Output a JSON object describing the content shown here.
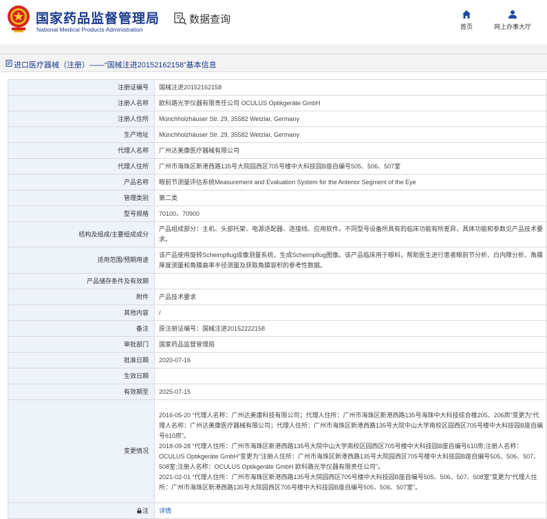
{
  "header": {
    "logo_cn": "国家药品监督管理局",
    "logo_en": "National Medical Products Administration",
    "query_label": "数据查询",
    "nav": [
      {
        "label": "首页",
        "icon": "home-icon"
      },
      {
        "label": "网上办事大厅",
        "icon": "user-icon"
      }
    ]
  },
  "panel": {
    "title": "进口医疗器械（注册）——“国械注进20152162158”基本信息",
    "title_icon": "document-icon"
  },
  "details": [
    {
      "label": "注册证编号",
      "value": "国械注进20152162158"
    },
    {
      "label": "注册人名称",
      "value": "欧科路光学仪器有限责任公司 OCULUS Optikgeräte GmbH"
    },
    {
      "label": "注册人住所",
      "value": "Münchholzhäuser Str. 29, 35582 Wetzlar, Germany"
    },
    {
      "label": "生产地址",
      "value": "Münchholzhäuser Str. 29, 35582 Wetzlar, Germany"
    },
    {
      "label": "代理人名称",
      "value": "广州达美康医疗器械有限公司"
    },
    {
      "label": "代理人住所",
      "value": "广州市海珠区新港西路135号大院园西区705号楼中大科技园B座自编号505、506、507室"
    },
    {
      "label": "产品名称",
      "value": "眼前节测量评估系统Measurement and Evaluation System for the Anterior Segment of the Eye"
    },
    {
      "label": "管理类别",
      "value": "第二类"
    },
    {
      "label": "型号规格",
      "value": "70100、70900"
    },
    {
      "label": "结构及组成/主要组成成分",
      "value": "产品组成部分：主机、头部托架、电源适配器、连接线、应用软件。不同型号设备所具有的临床功能有所差异，具体功能和参数见产品技术要求。"
    },
    {
      "label": "适用范围/预期用途",
      "value": "该产品使用旋转Scheimpflug成像测量系统，生成Scheimpflug图像。该产品临床用于眼科，帮助医生进行患者眼前节分析、白内障分析、角膜厚度测量和角膜曲率半径测量及获取角膜容积的参考性数据。"
    },
    {
      "label": "产品储存条件及有效期",
      "value": ""
    },
    {
      "label": "附件",
      "value": "产品技术要求"
    },
    {
      "label": "其他内容",
      "value": "/"
    },
    {
      "label": "备注",
      "value": "原注册证编号：国械注进20152222158"
    },
    {
      "label": "审批部门",
      "value": "国家药品监督管理局"
    },
    {
      "label": "批准日期",
      "value": "2020-07-16"
    },
    {
      "label": "生效日期",
      "value": ""
    },
    {
      "label": "有效期至",
      "value": "2025-07-15"
    }
  ],
  "change": {
    "label": "变更情况",
    "entries": [
      "2016-05-20 “代理人名称：广州达美康科技有限公司；代理人住所：广州市海珠区新港西路135号海珠中大科技综合楼205、206房”变更为“代理人名称：广州达美康医疗器械有限公司；代理人住所：广州市海珠区新港西路135号大院中山大学南校区园西区705号楼中大科技园B座自编号610房”。",
      "2018-09-28 “代理人住所：广州市海珠区新港西路135号大院中山大学南校区园西区705号楼中大科技园B座自编号610房;注册人名称：OCULUS Optikgeräte GmbH”变更为“注册人住所：广州市海珠区新港西路135号大院园西区705号楼中大科技园B座自编号505、506、507、508室;注册人名称：OCULUS Optikgeräte GmbH 欧科路光学仪器有限责任公司”。",
      "2021-02-01 “代理人住所：广州市海珠区新港西路135号大院园西区705号楼中大科技园B座自编号505、506、507、508室”变更为“代理人住所：广州市海珠区新港西路135号大院园西区705号楼中大科技园B座自编号505、506、507室”。"
    ]
  },
  "note_row": {
    "label": "注",
    "link_text": "详情"
  }
}
